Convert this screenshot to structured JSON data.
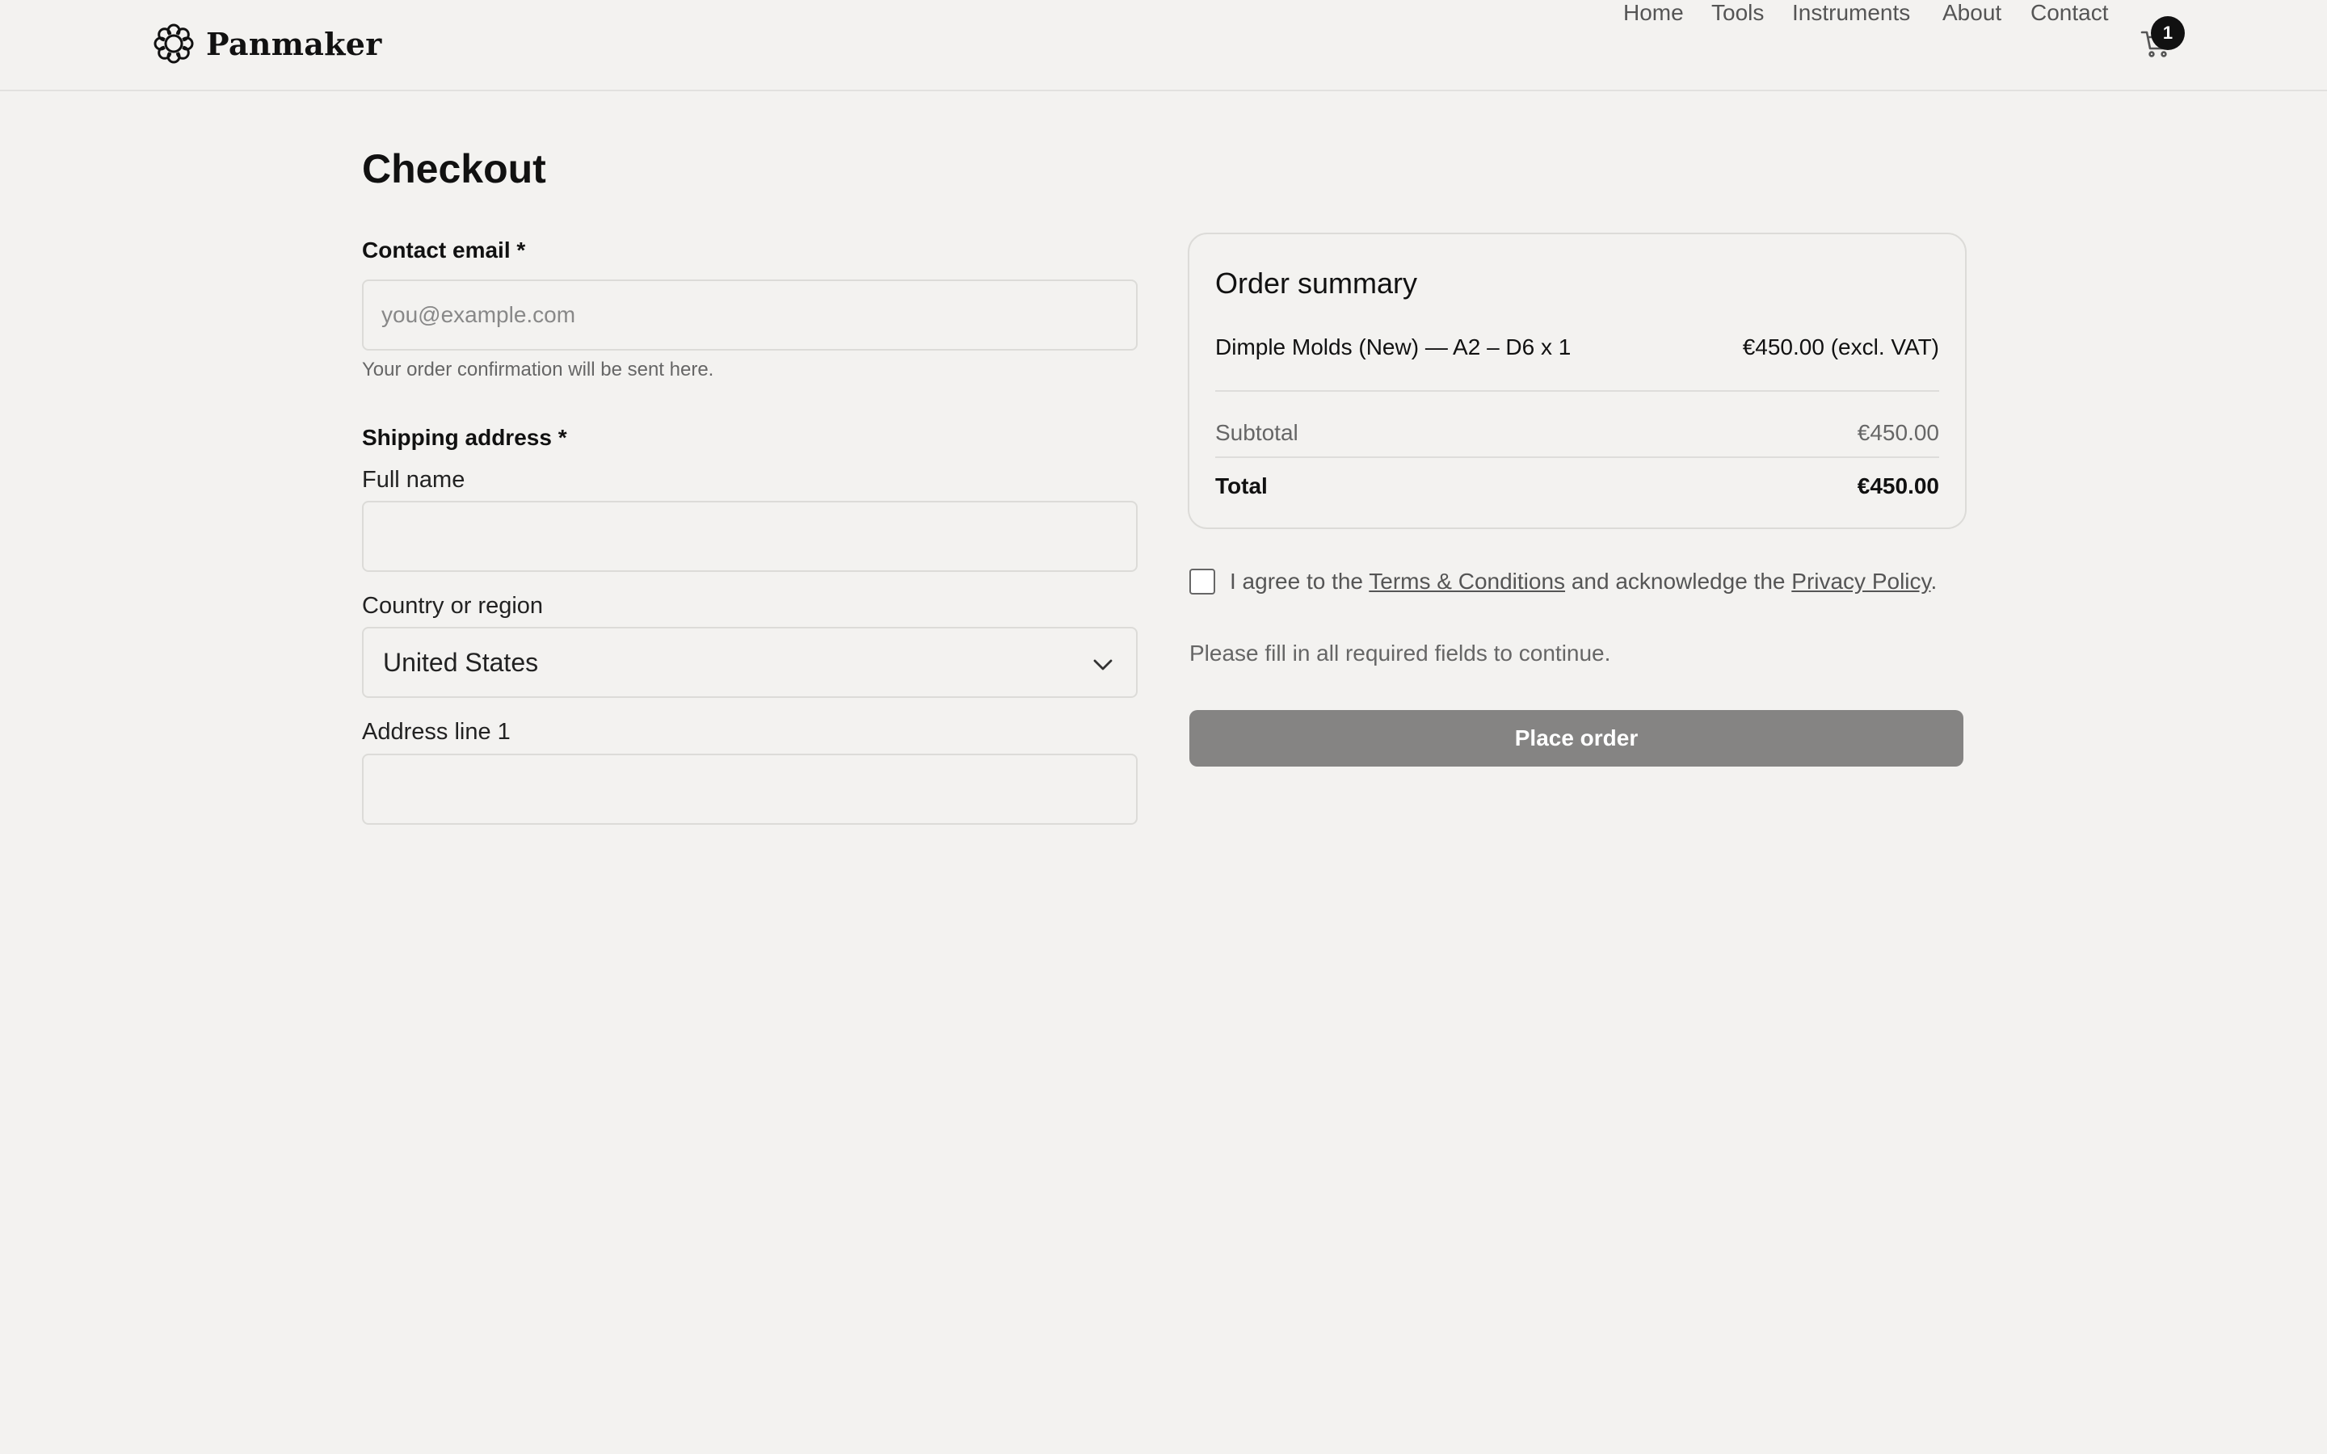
{
  "brand": {
    "name": "Panmaker",
    "logo_icon": "flower-logo-icon"
  },
  "nav": {
    "items": [
      {
        "label": "Home"
      },
      {
        "label": "Tools"
      },
      {
        "label": "Instruments"
      },
      {
        "label": "About"
      },
      {
        "label": "Contact"
      }
    ],
    "cart": {
      "icon": "cart-icon",
      "count": "1"
    }
  },
  "checkout": {
    "title": "Checkout",
    "contact": {
      "label": "Contact email *",
      "placeholder": "you@example.com",
      "value": "",
      "hint": "Your order confirmation will be sent here."
    },
    "shipping": {
      "label": "Shipping address *",
      "full_name_label": "Full name",
      "full_name_value": "",
      "country_label": "Country or region",
      "country_value": "United States",
      "address1_label": "Address line 1",
      "address1_value": ""
    }
  },
  "summary": {
    "title": "Order summary",
    "item": {
      "name": "Dimple Molds (New) — A2 – D6 x 1",
      "price": "€450.00 (excl. VAT)"
    },
    "subtotal_label": "Subtotal",
    "subtotal_value": "€450.00",
    "total_label": "Total",
    "total_value": "€450.00"
  },
  "agreement": {
    "prefix": "I agree to the ",
    "terms_link": "Terms & Conditions",
    "middle": " and acknowledge the ",
    "privacy_link": "Privacy Policy",
    "suffix": ".",
    "checked": false
  },
  "notice": "Please fill in all required fields to continue.",
  "place_order_label": "Place order",
  "colors": {
    "background": "#f3f2f0",
    "button_disabled": "#858483",
    "text": "#111111",
    "muted": "#555555"
  }
}
